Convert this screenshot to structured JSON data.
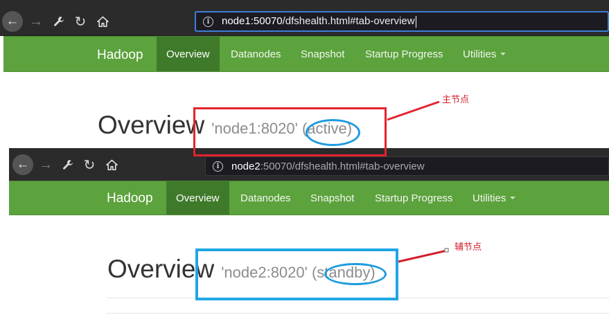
{
  "window1": {
    "url_host": "node1:50070",
    "url_path": "/dfshealth.html#tab-overview",
    "brand": "Hadoop",
    "nav": [
      "Overview",
      "Datanodes",
      "Snapshot",
      "Startup Progress",
      "Utilities"
    ],
    "active_tab": "Overview",
    "title": "Overview",
    "subtitle": "'node1:8020' (active)"
  },
  "window2": {
    "url_host": "node2",
    "url_path": ":50070/dfshealth.html#tab-overview",
    "brand": "Hadoop",
    "nav": [
      "Overview",
      "Datanodes",
      "Snapshot",
      "Startup Progress",
      "Utilities"
    ],
    "active_tab": "Overview",
    "title": "Overview",
    "subtitle": "'node2:8020' (standby)"
  },
  "annotations": {
    "primary_label": "主节点",
    "secondary_label": "辅节点",
    "primary_color": "#e3232d",
    "secondary_color": "#1fa6e5"
  },
  "icons": [
    "back-arrow-icon",
    "forward-arrow-icon",
    "wrench-icon",
    "reload-icon",
    "home-icon",
    "info-icon"
  ],
  "colors": {
    "navbar_green": "#5ca23d",
    "navbar_active": "#3f7a2a",
    "chrome_dark": "#2b2b2b"
  }
}
